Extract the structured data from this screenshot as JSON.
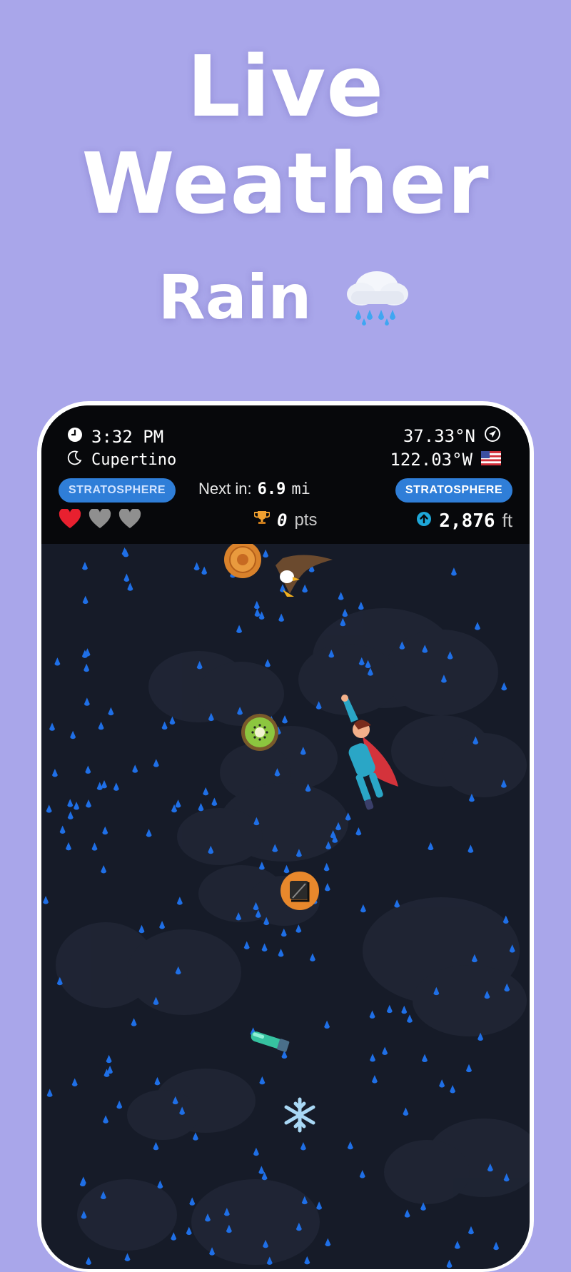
{
  "headline": {
    "line1": "Live",
    "line2": "Weather",
    "line3": "Rain"
  },
  "hud": {
    "time": "3:32 PM",
    "city": "Cupertino",
    "latitude": "37.33°N",
    "longitude": "122.03°W",
    "layer_left": "STRATOSPHERE",
    "layer_right": "STRATOSPHERE",
    "next_label": "Next in:",
    "next_value": "6.9",
    "next_unit": "mi",
    "points_value": "0",
    "points_unit": "pts",
    "altitude_value": "2,876",
    "altitude_unit": "ft",
    "lives_total": 3,
    "lives_remaining": 1
  },
  "icons": [
    "clock-icon",
    "moon-icon",
    "location-arrow-icon",
    "us-flag-icon",
    "heart-icon",
    "trophy-icon",
    "altitude-up-icon",
    "rain-cloud-icon"
  ],
  "colors": {
    "background": "#a9a6ea",
    "sky": "#161b28",
    "badge": "#2f7ed8",
    "raindrop": "#1f6fe6",
    "altitude_icon": "#1ea7d8"
  }
}
